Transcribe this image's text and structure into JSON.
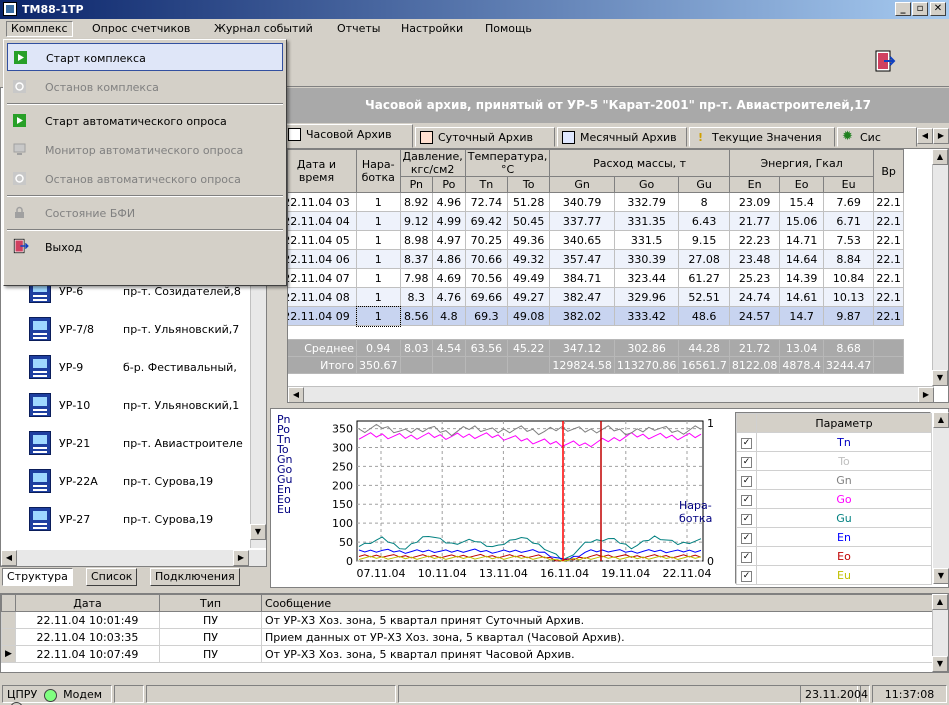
{
  "window": {
    "title": "ТМ88-1ТР"
  },
  "menubar": [
    "Комплекс",
    "Опрос счетчиков",
    "Журнал событий",
    "Отчеты",
    "Настройки",
    "Помощь"
  ],
  "dropdown": {
    "items": [
      {
        "label": "Старт комплекса",
        "state": "selected"
      },
      {
        "label": "Останов комплекса",
        "state": "disabled"
      },
      {
        "label": "Старт автоматического опроса",
        "state": "enabled"
      },
      {
        "label": "Монитор автоматического опроса",
        "state": "disabled"
      },
      {
        "label": "Останов автоматического опроса",
        "state": "disabled"
      },
      {
        "label": "Состояние БФИ",
        "state": "disabled"
      },
      {
        "label": "Выход",
        "state": "enabled"
      }
    ]
  },
  "archive_header": "Часовой архив, принятый от УР-5 \"Карат-2001\" пр-т. Авиастроителей,17",
  "tabs": [
    "Часовой Архив",
    "Суточный Архив",
    "Месячный Архив",
    "Текущие Значения",
    "Сис"
  ],
  "grid": {
    "group_headers": [
      "Дата и время",
      "Нара- ботка",
      "Давление, кгс/см2",
      "Температура, °С",
      "Расход массы, т",
      "Энергия, Гкал",
      "Вр"
    ],
    "sub_headers": [
      "Pn",
      "Po",
      "Tn",
      "To",
      "Gn",
      "Go",
      "Gu",
      "En",
      "Eo",
      "Eu"
    ],
    "rows": [
      [
        "22.11.04 03",
        "1",
        "8.92",
        "4.96",
        "72.74",
        "51.28",
        "340.79",
        "332.79",
        "8",
        "23.09",
        "15.4",
        "7.69",
        "22.1"
      ],
      [
        "22.11.04 04",
        "1",
        "9.12",
        "4.99",
        "69.42",
        "50.45",
        "337.77",
        "331.35",
        "6.43",
        "21.77",
        "15.06",
        "6.71",
        "22.1"
      ],
      [
        "22.11.04 05",
        "1",
        "8.98",
        "4.97",
        "70.25",
        "49.36",
        "340.65",
        "331.5",
        "9.15",
        "22.23",
        "14.71",
        "7.53",
        "22.1"
      ],
      [
        "22.11.04 06",
        "1",
        "8.37",
        "4.86",
        "70.66",
        "49.32",
        "357.47",
        "330.39",
        "27.08",
        "23.48",
        "14.64",
        "8.84",
        "22.1"
      ],
      [
        "22.11.04 07",
        "1",
        "7.98",
        "4.69",
        "70.56",
        "49.49",
        "384.71",
        "323.44",
        "61.27",
        "25.23",
        "14.39",
        "10.84",
        "22.1"
      ],
      [
        "22.11.04 08",
        "1",
        "8.3",
        "4.76",
        "69.66",
        "49.27",
        "382.47",
        "329.96",
        "52.51",
        "24.74",
        "14.61",
        "10.13",
        "22.1"
      ],
      [
        "22.11.04 09",
        "1",
        "8.56",
        "4.8",
        "69.3",
        "49.08",
        "382.02",
        "333.42",
        "48.6",
        "24.57",
        "14.7",
        "9.87",
        "22.1"
      ]
    ],
    "avg": [
      "Среднее",
      "0.94",
      "8.03",
      "4.54",
      "63.56",
      "45.22",
      "347.12",
      "302.86",
      "44.28",
      "21.72",
      "13.04",
      "8.68",
      ""
    ],
    "total": [
      "Итого",
      "350.67",
      "",
      "",
      "",
      "",
      "129824.58",
      "113270.86",
      "16561.7",
      "8122.08",
      "4878.4",
      "3244.47",
      ""
    ]
  },
  "left_devices": [
    {
      "name": "УР-6",
      "addr": "пр-т. Созидателей,8"
    },
    {
      "name": "УР-7/8",
      "addr": "пр-т. Ульяновский,7"
    },
    {
      "name": "УР-9",
      "addr": "б-р. Фестивальный,"
    },
    {
      "name": "УР-10",
      "addr": "пр-т. Ульяновский,1"
    },
    {
      "name": "УР-21",
      "addr": "пр-т. Авиастроителе"
    },
    {
      "name": "УР-22А",
      "addr": "пр-т. Сурова,19"
    },
    {
      "name": "УР-27",
      "addr": "пр-т. Сурова,19"
    }
  ],
  "left_tabs": [
    "Структура",
    "Список",
    "Подключения"
  ],
  "chart_legend": [
    "Pn",
    "Po",
    "Tn",
    "To",
    "Gn",
    "Go",
    "Gu",
    "En",
    "Eo",
    "Eu"
  ],
  "chart_data": {
    "type": "line",
    "x_ticks": [
      "07.11.04",
      "10.11.04",
      "13.11.04",
      "16.11.04",
      "19.11.04",
      "22.11.04"
    ],
    "y_ticks": [
      "0",
      "50",
      "100",
      "150",
      "200",
      "250",
      "300",
      "350"
    ],
    "ylim": [
      0,
      370
    ],
    "right_axis_label": "Нара- ботка",
    "right_ticks": [
      "1",
      "0"
    ],
    "series": [
      {
        "name": "Go",
        "color": "#ff00ff",
        "approx": [
          330,
          332,
          328,
          331,
          329,
          332,
          330,
          322,
          315,
          310,
          308,
          320,
          332,
          330,
          328,
          331
        ]
      },
      {
        "name": "Tn",
        "color": "#808080",
        "approx": [
          345,
          355,
          340,
          352,
          338,
          354,
          342,
          350,
          341,
          352,
          344,
          350,
          338,
          354,
          340,
          352
        ]
      },
      {
        "name": "Gu",
        "color": "#008080",
        "approx": [
          40,
          60,
          30,
          70,
          45,
          55,
          35,
          65,
          40,
          0,
          50,
          60,
          35,
          65,
          45,
          55
        ]
      },
      {
        "name": "En",
        "color": "#0000ff",
        "approx": [
          25,
          28,
          24,
          27,
          25,
          28,
          24,
          27,
          25,
          0,
          25,
          28,
          24,
          27,
          25,
          28
        ]
      },
      {
        "name": "Eo",
        "color": "#c00000",
        "approx": [
          12,
          14,
          12,
          13,
          12,
          14,
          12,
          13,
          12,
          0,
          12,
          14,
          12,
          13,
          12,
          14
        ]
      },
      {
        "name": "Eu",
        "color": "#c0c000",
        "approx": [
          8,
          9,
          8,
          9,
          8,
          9,
          8,
          9,
          8,
          0,
          8,
          9,
          8,
          9,
          8,
          9
        ]
      }
    ]
  },
  "params": {
    "header": "Параметр",
    "items": [
      {
        "name": "Tn",
        "color": "#0000c0"
      },
      {
        "name": "To",
        "color": "#c0c0c0"
      },
      {
        "name": "Gn",
        "color": "#808080"
      },
      {
        "name": "Go",
        "color": "#ff00ff"
      },
      {
        "name": "Gu",
        "color": "#008080"
      },
      {
        "name": "En",
        "color": "#0000ff"
      },
      {
        "name": "Eo",
        "color": "#c00000"
      },
      {
        "name": "Eu",
        "color": "#c0c000"
      }
    ]
  },
  "log": {
    "headers": [
      "Дата",
      "Тип",
      "Сообщение"
    ],
    "rows": [
      [
        "22.11.04 10:01:49",
        "ПУ",
        "От УР-Х3 Хоз. зона, 5 квартал принят Суточный Архив."
      ],
      [
        "22.11.04 10:03:35",
        "ПУ",
        "Прием данных от УР-Х3 Хоз. зона, 5 квартал (Часовой Архив)."
      ],
      [
        "22.11.04 10:07:49",
        "ПУ",
        "От УР-Х3 Хоз. зона, 5 квартал принят Часовой Архив."
      ]
    ]
  },
  "status": {
    "cpu_label": "ЦПРУ",
    "modem_label": "Модем",
    "date": "23.11.2004",
    "time": "11:37:08"
  }
}
